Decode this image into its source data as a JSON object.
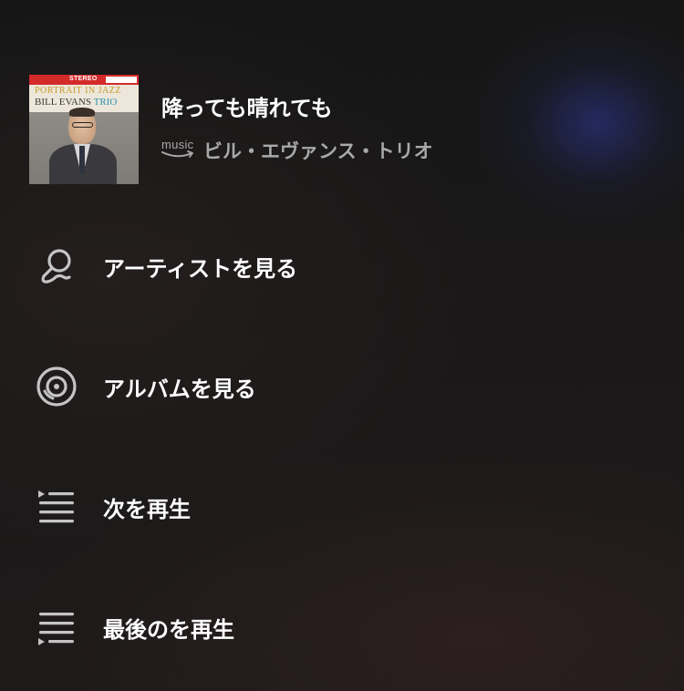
{
  "now_playing": {
    "title": "降っても晴れても",
    "artist": "ビル・エヴァンス・トリオ",
    "service_logo_text": "music",
    "cover": {
      "stereo_label": "STEREO",
      "album_line": "PORTRAIT IN JAZZ",
      "band_line_1": "BILL EVANS",
      "band_line_2": "TRIO"
    }
  },
  "menu": {
    "items": [
      {
        "label": "アーティストを見る",
        "icon": "microphone-icon"
      },
      {
        "label": "アルバムを見る",
        "icon": "album-disc-icon"
      },
      {
        "label": "次を再生",
        "icon": "play-next-icon"
      },
      {
        "label": "最後のを再生",
        "icon": "play-last-icon"
      }
    ]
  },
  "colors": {
    "primary_text": "#ffffff",
    "secondary_text": "#a9a9a9",
    "icon": "#c4c4c4",
    "background": "#1a1818",
    "glow": "#283078"
  }
}
